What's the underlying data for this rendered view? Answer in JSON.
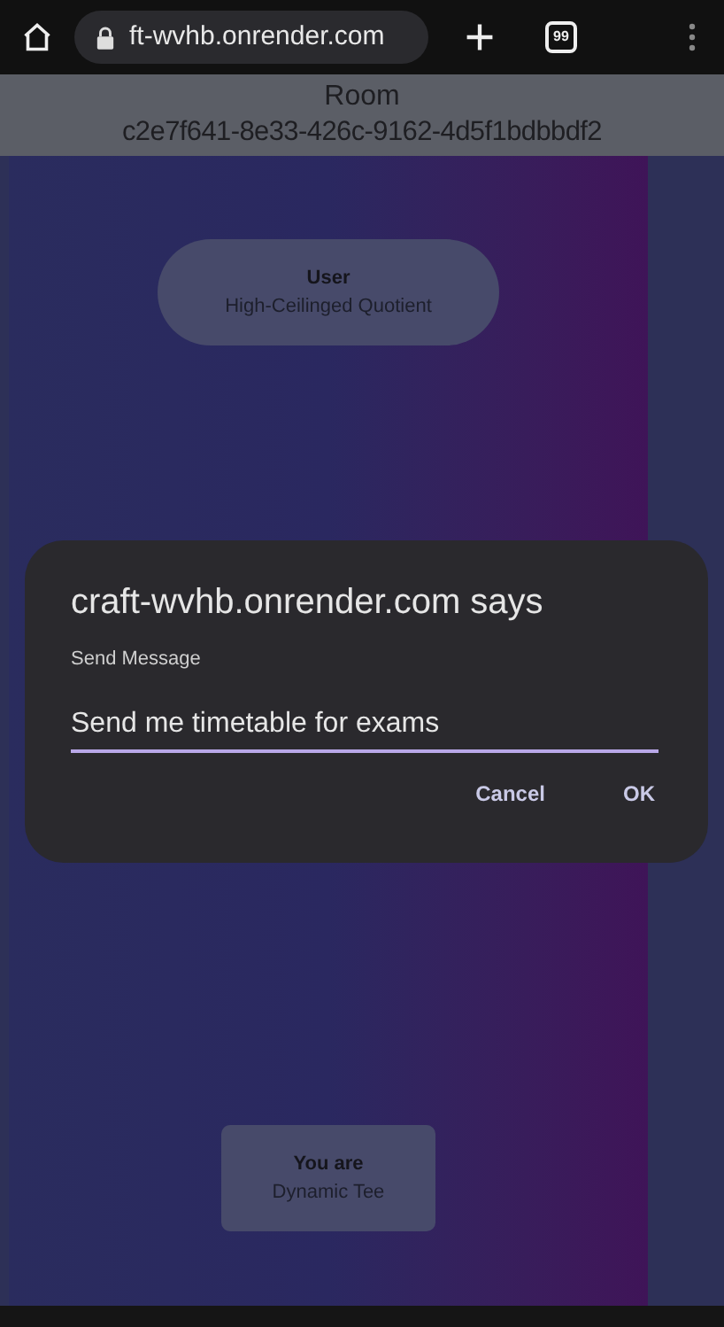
{
  "browser": {
    "url": "ft-wvhb.onrender.com",
    "tab_count": "99"
  },
  "header": {
    "title": "Room",
    "room_id": "c2e7f641-8e33-426c-9162-4d5f1bdbbdf2"
  },
  "user_card": {
    "label": "User",
    "name": "High-Ceilinged Quotient"
  },
  "self_card": {
    "label": "You are",
    "name": "Dynamic Tee"
  },
  "dialog": {
    "title": "craft-wvhb.onrender.com says",
    "message": "Send Message",
    "value": "Send me timetable for exams",
    "buttons": [
      "Cancel",
      "OK"
    ]
  }
}
